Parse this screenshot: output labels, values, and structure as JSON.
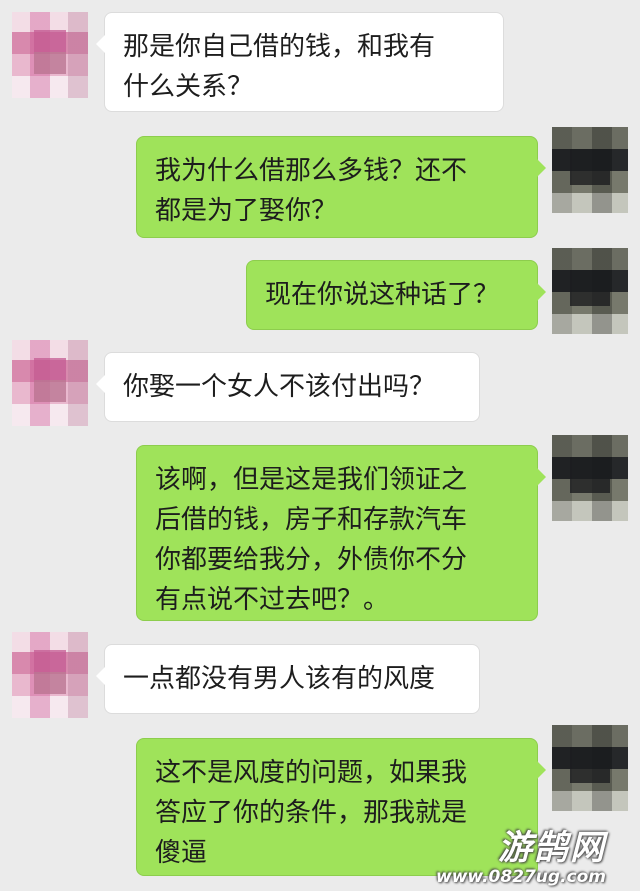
{
  "messages": [
    {
      "side": "left",
      "text": "那是你自己借的钱，和我有\n什么关系？"
    },
    {
      "side": "right",
      "text": "我为什么借那么多钱？还不\n都是为了娶你？"
    },
    {
      "side": "right",
      "text": "现在你说这种话了？"
    },
    {
      "side": "left",
      "text": "你娶一个女人不该付出吗？"
    },
    {
      "side": "right",
      "text": "该啊，但是这是我们领证之\n后借的钱，房子和存款汽车\n你都要给我分，外债你不分\n有点说不过去吧？。"
    },
    {
      "side": "left",
      "text": "一点都没有男人该有的风度"
    },
    {
      "side": "right",
      "text": "这不是风度的问题，如果我\n答应了你的条件，那我就是\n傻逼"
    }
  ],
  "watermark": {
    "logo": "游鹄网",
    "url": "www.0827ug.com"
  },
  "colors": {
    "background": "#ebebeb",
    "sent_bubble": "#9fe35a",
    "received_bubble": "#ffffff"
  }
}
